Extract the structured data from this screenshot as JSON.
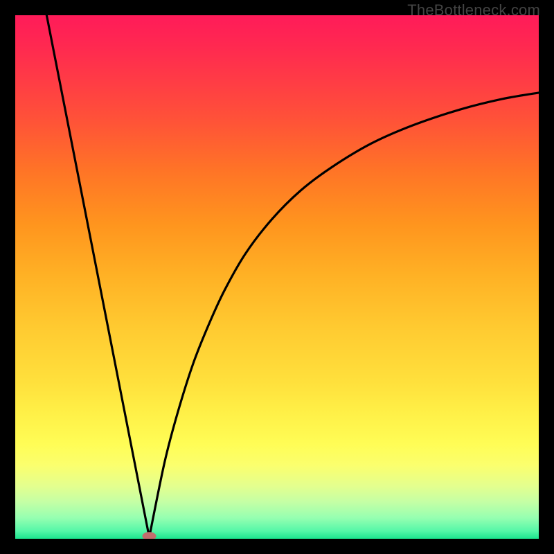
{
  "watermark": "TheBottleneck.com",
  "chart_data": {
    "type": "line",
    "title": "",
    "xlabel": "",
    "ylabel": "",
    "xlim": [
      0,
      1
    ],
    "ylim": [
      0,
      1
    ],
    "background_gradient": {
      "stops": [
        {
          "offset": 0,
          "color": "#ff1b59"
        },
        {
          "offset": 0.06,
          "color": "#ff2950"
        },
        {
          "offset": 0.12,
          "color": "#ff3a46"
        },
        {
          "offset": 0.2,
          "color": "#ff5238"
        },
        {
          "offset": 0.3,
          "color": "#ff7526"
        },
        {
          "offset": 0.4,
          "color": "#ff951e"
        },
        {
          "offset": 0.5,
          "color": "#ffb225"
        },
        {
          "offset": 0.6,
          "color": "#ffcb31"
        },
        {
          "offset": 0.7,
          "color": "#ffe03c"
        },
        {
          "offset": 0.76,
          "color": "#fff047"
        },
        {
          "offset": 0.82,
          "color": "#fffd56"
        },
        {
          "offset": 0.86,
          "color": "#fbff6e"
        },
        {
          "offset": 0.9,
          "color": "#e3ff8f"
        },
        {
          "offset": 0.93,
          "color": "#c4ffa5"
        },
        {
          "offset": 0.96,
          "color": "#96ffb1"
        },
        {
          "offset": 0.985,
          "color": "#55f7a8"
        },
        {
          "offset": 1.0,
          "color": "#1be48e"
        }
      ]
    },
    "series": [
      {
        "name": "left-branch",
        "x": [
          0.06,
          0.256
        ],
        "y": [
          0.0,
          1.0
        ],
        "note": "y measured from top; value shown is (1 - y_from_top); straight line from (0.06,1.0 top) to nadir."
      },
      {
        "name": "right-branch",
        "x": [
          0.256,
          0.285,
          0.31,
          0.34,
          0.37,
          0.4,
          0.44,
          0.49,
          0.545,
          0.605,
          0.68,
          0.76,
          0.85,
          0.93,
          1.0
        ],
        "y": [
          1.0,
          0.855,
          0.76,
          0.665,
          0.59,
          0.525,
          0.455,
          0.39,
          0.335,
          0.29,
          0.245,
          0.21,
          0.18,
          0.16,
          0.148
        ],
        "note": "y measured from top (0=top, 1=bottom). Curve rises steeply from nadir then asymptotes."
      }
    ],
    "nadir_marker": {
      "x": 0.256,
      "y_from_top": 0.995,
      "color": "#c26d6d",
      "rx": 10,
      "ry": 6
    }
  }
}
